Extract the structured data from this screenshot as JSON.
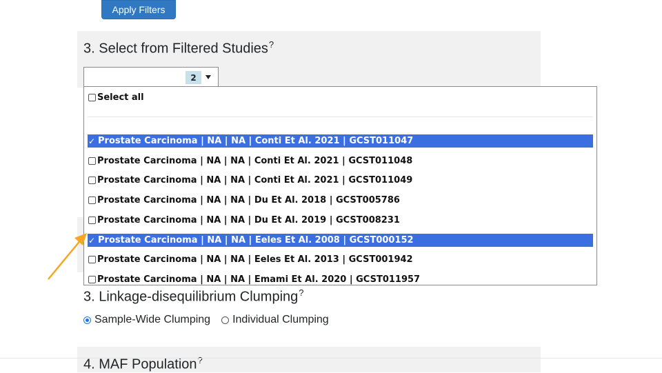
{
  "apply_button": {
    "label": "Apply Filters"
  },
  "section_select": {
    "title": "3. Select from Filtered Studies",
    "help_mark": "?"
  },
  "select_box": {
    "count": "2"
  },
  "dropdown": {
    "select_all_label": "Select all",
    "options": [
      {
        "label": "Prostate Carcinoma | NA | NA | Conti Et Al. 2021 | GCST011047",
        "checked": true
      },
      {
        "label": "Prostate Carcinoma | NA | NA | Conti Et Al. 2021 | GCST011048",
        "checked": false
      },
      {
        "label": "Prostate Carcinoma | NA | NA | Conti Et Al. 2021 | GCST011049",
        "checked": false
      },
      {
        "label": "Prostate Carcinoma | NA | NA | Du Et Al. 2018 | GCST005786",
        "checked": false
      },
      {
        "label": "Prostate Carcinoma | NA | NA | Du Et Al. 2019 | GCST008231",
        "checked": false
      },
      {
        "label": "Prostate Carcinoma | NA | NA | Eeles Et Al. 2008 | GCST000152",
        "checked": true
      },
      {
        "label": "Prostate Carcinoma | NA | NA | Eeles Et Al. 2013 | GCST001942",
        "checked": false
      },
      {
        "label": "Prostate Carcinoma | NA | NA | Emami Et Al. 2020 | GCST011957",
        "checked": false
      }
    ],
    "check_mark": "✓",
    "selected_color": "#3a6fe0"
  },
  "section_ld": {
    "title": "3. Linkage-disequilibrium Clumping",
    "help_mark": "?",
    "options": [
      {
        "label": "Sample-Wide Clumping",
        "selected": true
      },
      {
        "label": "Individual Clumping",
        "selected": false
      }
    ]
  },
  "section_maf": {
    "title": "4. MAF Population",
    "help_mark": "?"
  },
  "annotation": {
    "arrow_color": "#f5a623"
  },
  "colors": {
    "primary_button": "#3079c2",
    "panel_bg": "#f1f1f1"
  }
}
